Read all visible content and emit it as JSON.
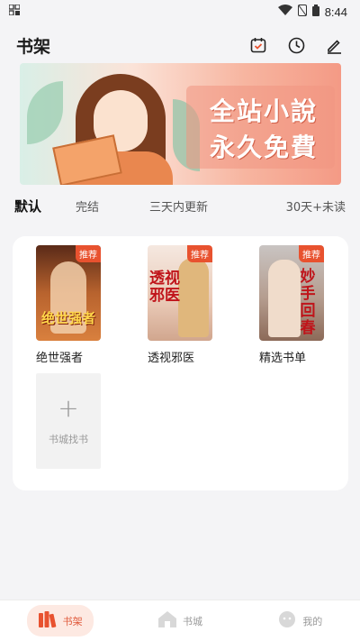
{
  "status_bar": {
    "time": "8:44"
  },
  "header": {
    "title": "书架"
  },
  "banner": {
    "line1": "全站小說",
    "line2": "永久免費"
  },
  "filters": {
    "default": "默认",
    "finished": "完结",
    "recent": "三天内更新",
    "unread": "30天+未读"
  },
  "books": [
    {
      "title": "绝世强者",
      "tag": "推荐",
      "cover_text": "绝世强者"
    },
    {
      "title": "透视邪医",
      "tag": "推荐",
      "cover_text": "透视邪医"
    },
    {
      "title": "精选书单",
      "tag": "推荐",
      "cover_text": "妙手回春"
    }
  ],
  "add_book": {
    "plus": "+",
    "label": "书城找书"
  },
  "nav": {
    "bookshelf": "书架",
    "bookstore": "书城",
    "mine": "我的"
  },
  "colors": {
    "accent": "#e8522f",
    "nav_active_bg": "#fde9e2"
  }
}
